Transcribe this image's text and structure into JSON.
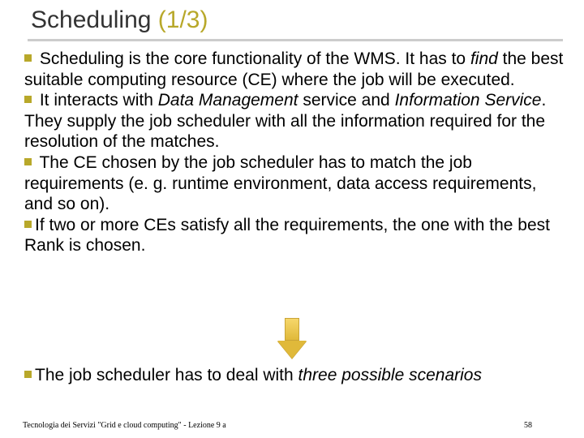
{
  "title": {
    "main": "Scheduling",
    "counter": "(1/3)"
  },
  "bullets": {
    "b1": {
      "t1": " Scheduling is the core functionality of  the WMS. It has to ",
      "i1": "find",
      "t2": " the best suitable computing resource (CE) where the job will be executed."
    },
    "b2": {
      "t1": " It interacts with ",
      "i1": "Data Management",
      "t2": " service and ",
      "i2": "Information Service",
      "t3": ". They supply the job scheduler with all the information required for the resolution of the matches."
    },
    "b3": {
      "t1": " The CE chosen by the job scheduler has to match the job requirements (e. g. runtime environment, data access requirements, and so on)."
    },
    "b4": {
      "t1": "If  two or more CEs satisfy all the requirements, the one with the best Rank is chosen."
    }
  },
  "closing": {
    "t1": "The  job scheduler has to deal with ",
    "i1": "three possible scenarios"
  },
  "footer": {
    "left": "Tecnologia dei Servizi \"Grid e cloud computing\" - Lezione 9 a",
    "page": "58"
  },
  "colors": {
    "accent": "#b8a82a"
  }
}
